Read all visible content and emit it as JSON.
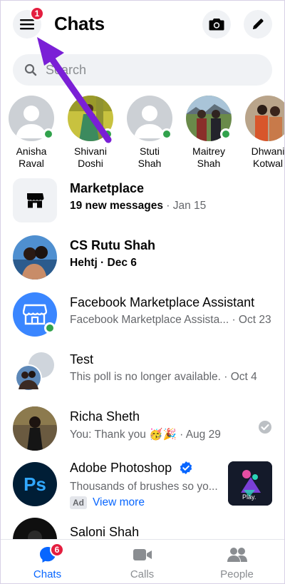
{
  "header": {
    "title": "Chats",
    "menu_badge": "1"
  },
  "search": {
    "placeholder": "Search"
  },
  "stories": [
    {
      "line1": "Anisha",
      "line2": "Raval"
    },
    {
      "line1": "Shivani",
      "line2": "Doshi"
    },
    {
      "line1": "Stuti",
      "line2": "Shah"
    },
    {
      "line1": "Maitrey",
      "line2": "Shah"
    },
    {
      "line1": "Dhwani",
      "line2": "Kotwal"
    }
  ],
  "chats": [
    {
      "name": "Marketplace",
      "preview": "19 new messages",
      "time": " · Jan 15"
    },
    {
      "name": "CS Rutu Shah",
      "preview": "Hehtj · Dec 6",
      "time": ""
    },
    {
      "name": "Facebook Marketplace Assistant",
      "preview": "Facebook Marketplace Assista...",
      "time": " · Oct 23"
    },
    {
      "name": "Test",
      "preview": "This poll is no longer available.",
      "time": " · Oct 4"
    },
    {
      "name": "Richa Sheth",
      "preview": "You: Thank you 🥳🎉",
      "time": " · Aug 29"
    },
    {
      "name": "Adobe Photoshop",
      "preview": "Thousands of brushes so yo...",
      "ad_label": "Ad",
      "link": "View more",
      "thumb_text": "Play."
    },
    {
      "name": "Saloni Shah"
    }
  ],
  "nav": {
    "chats": "Chats",
    "chats_badge": "6",
    "calls": "Calls",
    "people": "People"
  },
  "colors": {
    "accent": "#0866ff",
    "online": "#31a24c",
    "badge": "#e41e3f",
    "arrow": "#7a1fd6"
  }
}
